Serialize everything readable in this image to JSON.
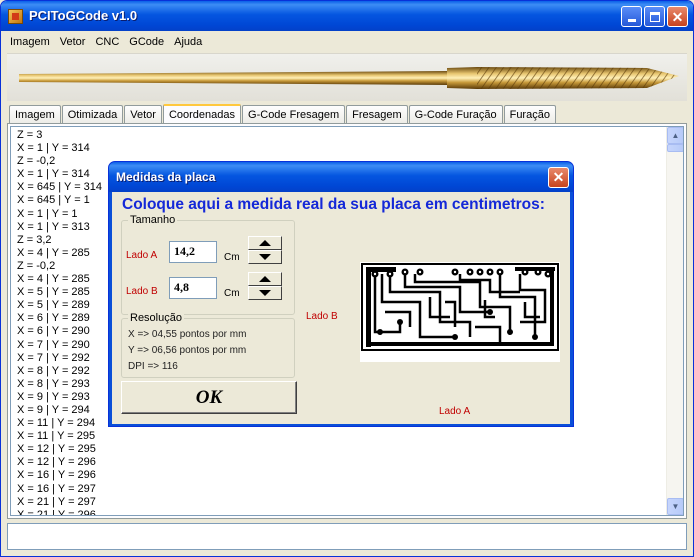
{
  "window": {
    "title": "PCIToGCode  v1.0",
    "minimize_icon": "minimize-icon",
    "maximize_icon": "maximize-icon",
    "close_icon": "close-icon"
  },
  "menu": [
    "Imagem",
    "Vetor",
    "CNC",
    "GCode",
    "Ajuda"
  ],
  "tabs": [
    {
      "label": "Imagem",
      "active": false
    },
    {
      "label": "Otimizada",
      "active": false
    },
    {
      "label": "Vetor",
      "active": false
    },
    {
      "label": "Coordenadas",
      "active": true
    },
    {
      "label": "G-Code Fresagem",
      "active": false
    },
    {
      "label": "Fresagem",
      "active": false
    },
    {
      "label": "G-Code Furação",
      "active": false
    },
    {
      "label": "Furação",
      "active": false
    }
  ],
  "coordinates": [
    "Z = 3",
    "X = 1 | Y = 314",
    "Z = -0,2",
    "X = 1 | Y = 314",
    "X = 645 | Y = 314",
    "X = 645 | Y = 1",
    "X = 1 | Y = 1",
    "X = 1 | Y = 313",
    "Z = 3,2",
    "X = 4 | Y = 285",
    "Z = -0,2",
    "X = 4 | Y = 285",
    "X = 5 | Y = 285",
    "X = 5 | Y = 289",
    "X = 6 | Y = 289",
    "X = 6 | Y = 290",
    "X = 7 | Y = 290",
    "X = 7 | Y = 292",
    "X = 8 | Y = 292",
    "X = 8 | Y = 293",
    "X = 9 | Y = 293",
    "X = 9 | Y = 294",
    "X = 11 | Y = 294",
    "X = 11 | Y = 295",
    "X = 12 | Y = 295",
    "X = 12 | Y = 296",
    "X = 16 | Y = 296",
    "X = 16 | Y = 297",
    "X = 21 | Y = 297",
    "X = 21 | Y = 296"
  ],
  "dialog": {
    "title": "Medidas da placa",
    "heading": "Coloque aqui a medida real da sua placa em centimetros:",
    "size_group": "Tamanho",
    "side_a_label": "Lado A",
    "side_a_value": "14,2",
    "side_b_label": "Lado B",
    "side_b_value": "4,8",
    "unit": "Cm",
    "resolution_group": "Resolução",
    "res_x": "X => 04,55 pontos por mm",
    "res_y": "Y => 06,56 pontos por mm",
    "dpi": "DPI => 116",
    "ok_label": "OK",
    "preview_side_b": "Lado B",
    "preview_side_a": "Lado A"
  },
  "colors": {
    "titlebar": "#0054E3",
    "heading": "#1428D8",
    "side_label": "#C00000",
    "active_tab_accent": "#FFC83C"
  }
}
